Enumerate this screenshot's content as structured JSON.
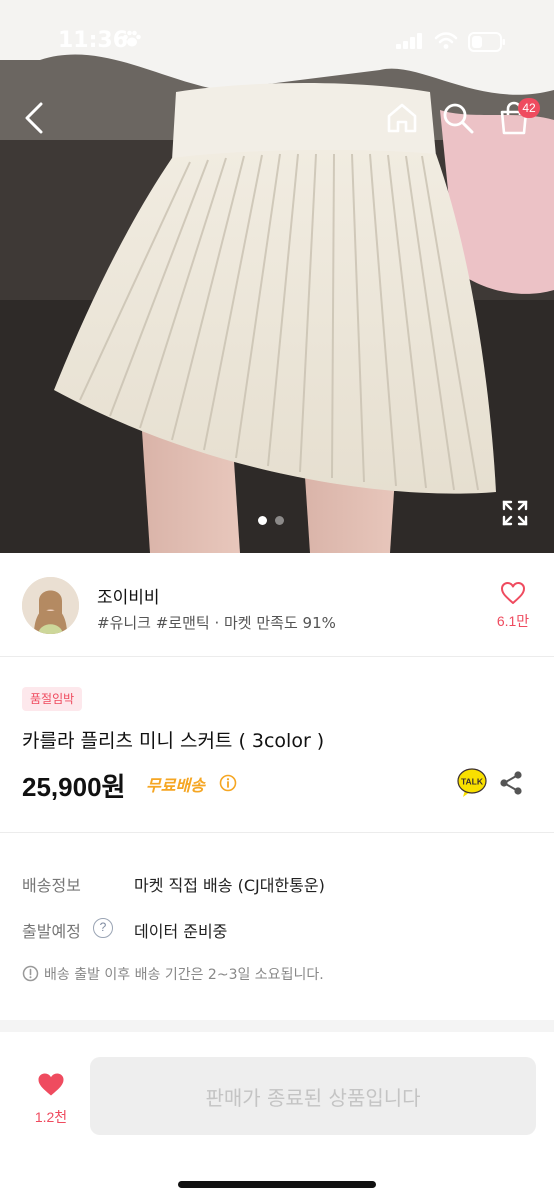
{
  "status_bar": {
    "time": "11:36"
  },
  "hero": {
    "nav": {
      "back_icon": "chevron-left-icon",
      "home_icon": "home-icon",
      "search_icon": "search-icon",
      "cart_icon": "shopping-bag-icon",
      "cart_badge": "42"
    },
    "pager": {
      "total": 2,
      "active": 1
    },
    "expand_icon": "expand-icon"
  },
  "shop": {
    "name": "조이비비",
    "tags": "#유니크 #로맨틱 · 마켓 만족도 91%",
    "like_count": "6.1만"
  },
  "product": {
    "badge": "품절임박",
    "title": "카를라 플리츠 미니 스커트 ( 3color )",
    "price": "25,900원",
    "free_shipping": "무료배송"
  },
  "delivery": {
    "rows": [
      {
        "label": "배송정보",
        "value": "마켓 직접 배송 (CJ대한통운)"
      },
      {
        "label": "출발예정",
        "value": "데이터 준비중"
      }
    ],
    "help_icon_text": "?",
    "note": "배송 출발 이후 배송 기간은 2~3일 소요됩니다."
  },
  "bottom": {
    "like_count": "1.2천",
    "status_button": "판매가 종료된 상품입니다"
  },
  "colors": {
    "accent_pink": "#ef4b5f",
    "free_ship_orange": "#f5a623",
    "kakao_yellow": "#f9e000"
  }
}
